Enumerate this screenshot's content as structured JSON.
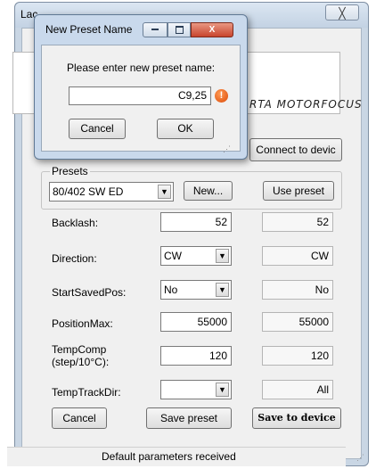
{
  "main_window": {
    "title": "Lac",
    "close_glyph": "╳",
    "brand_logo_text": "RTA MOTORFOCUS",
    "connect_button": "Connect to devic",
    "presets": {
      "group_label": "Presets",
      "selected": "80/402 SW ED",
      "new_button": "New...",
      "use_button": "Use preset"
    },
    "params": [
      {
        "label": "Backlash:",
        "value": "52",
        "device": "52"
      },
      {
        "label": "Direction:",
        "value": "CW",
        "device": "CW"
      },
      {
        "label": "StartSavedPos:",
        "value": "No",
        "device": "No"
      },
      {
        "label": "PositionMax:",
        "value": "55000",
        "device": "55000"
      },
      {
        "label_line1": "TempComp",
        "label_line2": "(step/10°C):",
        "value": "120",
        "device": "120"
      },
      {
        "label": "TempTrackDir:",
        "value": "",
        "device": "All"
      }
    ],
    "buttons": {
      "cancel": "Cancel",
      "save_preset": "Save preset",
      "save_device": "Save to device"
    },
    "status": "Default parameters received"
  },
  "dialog": {
    "title": "New Preset Name",
    "prompt": "Please enter new preset name:",
    "input_value": "C9,25",
    "warning_glyph": "!",
    "cancel": "Cancel",
    "ok": "OK"
  },
  "icons": {
    "combo_arrow": "▼",
    "grip": "⋰"
  }
}
